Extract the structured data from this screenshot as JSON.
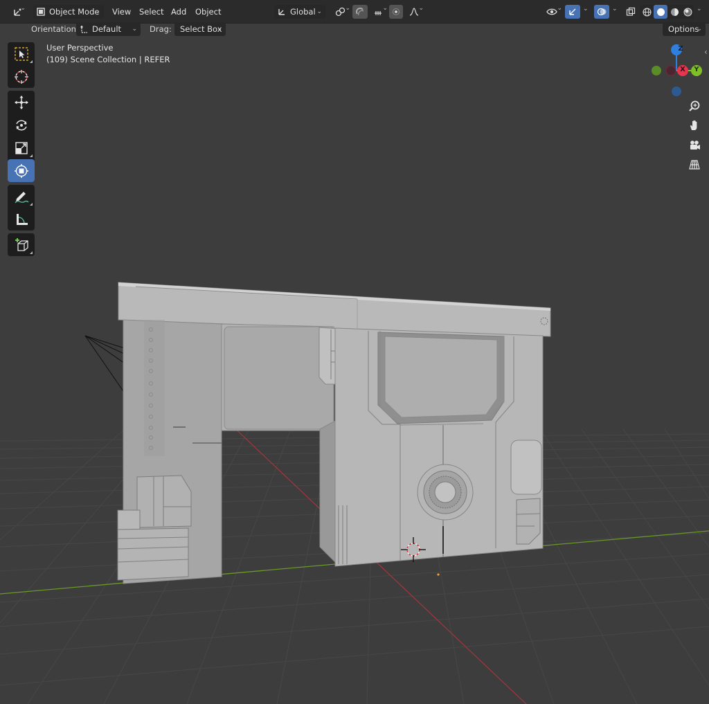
{
  "top_bar": {
    "mode_label": "Object Mode",
    "menus": [
      "View",
      "Select",
      "Add",
      "Object"
    ],
    "transform_orientation_label": "Global",
    "icons": {
      "editor_type": "editor-type-icon",
      "object_mode": "object-mode-icon",
      "transform_orientation": "transform-orientation-icon",
      "pivot": "pivot-point-icon",
      "snap": "snap-magnet-icon",
      "snap_target": "snap-increment-icon",
      "proportional": "proportional-editing-icon",
      "falloff": "falloff-curve-icon",
      "visibility": "object-visibility-icon",
      "gizmo": "gizmo-toggle-icon",
      "overlays": "overlays-icon",
      "xray": "xray-toggle-icon",
      "shading_wireframe": "wireframe-shading-icon",
      "shading_solid": "solid-shading-icon",
      "shading_material": "material-preview-icon",
      "shading_rendered": "rendered-shading-icon"
    }
  },
  "tool_header": {
    "orientation_label": "Orientation:",
    "orientation_value": "Default",
    "drag_label": "Drag:",
    "drag_value": "Select Box",
    "options_label": "Options"
  },
  "toolbar": {
    "tools": [
      {
        "name": "select-box-tool",
        "icon": "select-box-icon"
      },
      {
        "name": "cursor-tool",
        "icon": "cursor-icon"
      },
      {
        "name": "move-tool",
        "icon": "move-icon"
      },
      {
        "name": "rotate-tool",
        "icon": "rotate-icon"
      },
      {
        "name": "scale-tool",
        "icon": "scale-icon"
      },
      {
        "name": "transform-tool",
        "icon": "transform-icon",
        "active": true
      },
      {
        "name": "annotate-tool",
        "icon": "annotate-icon"
      },
      {
        "name": "measure-tool",
        "icon": "measure-icon"
      },
      {
        "name": "add-cube-tool",
        "icon": "add-cube-icon"
      }
    ]
  },
  "viewport": {
    "view_name": "User Perspective",
    "collection_info": "(109) Scene Collection | REFER",
    "gizmo": {
      "z_label": "Z",
      "x_label": "X",
      "y_label": "Y",
      "colors": {
        "x": "#e8344f",
        "y": "#7fbf26",
        "z": "#2e7fe0",
        "neg_y": "#5a8c28",
        "neg_x": "#7a2734",
        "neg_z": "#2c5a91"
      }
    },
    "nav_buttons": [
      "zoom-icon",
      "hand-pan-icon",
      "camera-icon",
      "grid-perspective-icon"
    ],
    "colors": {
      "background": "#3d3d3d",
      "grid_line": "#474747",
      "x_axis": "#a8343f",
      "y_axis": "#6a9a26",
      "mesh_light": "#c9c9c9",
      "mesh_mid": "#a9a9a9",
      "mesh_dark": "#8a8a8a",
      "accent": "#4772b3"
    }
  }
}
